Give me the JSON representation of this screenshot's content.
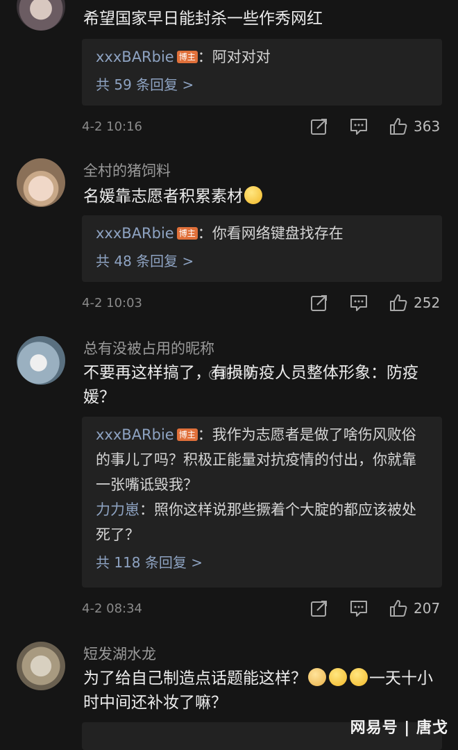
{
  "comments": [
    {
      "username": "",
      "text": "希望国家早日能封杀一些作秀网红",
      "replies": [
        {
          "name": "xxxBARbie",
          "badge": "博主",
          "text": "：阿对对对"
        }
      ],
      "reply_count": "共 59 条回复 >",
      "time": "4-2 10:16",
      "likes": "363"
    },
    {
      "username": "全村的猪饲料",
      "text": "名媛靠志愿者积累素材",
      "replies": [
        {
          "name": "xxxBARbie",
          "badge": "博主",
          "text": "：你看网络键盘找存在"
        }
      ],
      "reply_count": "共 48 条回复 >",
      "time": "4-2 10:03",
      "likes": "252"
    },
    {
      "username": "总有没被占用的昵称",
      "text": "不要再这样搞了，有损防疫人员整体形象：防疫媛？",
      "overlay_text": "@那件事",
      "replies": [
        {
          "name": "xxxBARbie",
          "badge": "博主",
          "text": "：我作为志愿者是做了啥伤风败俗的事儿了吗？积极正能量对抗疫情的付出，你就靠一张嘴诋毁我？"
        },
        {
          "name": "力力崽",
          "badge": "",
          "text": "：照你这样说那些撅着个大腚的都应该被处死了？"
        }
      ],
      "reply_count": "共 118 条回复 >",
      "time": "4-2 08:34",
      "likes": "207"
    },
    {
      "username": "短发湖水龙",
      "text_before": "为了给自己制造点话题能这样？",
      "text_after": "一天十小时中间还补妆了嘛？"
    }
  ],
  "watermark": "网易号 | 唐戈",
  "icons": [
    "share-icon",
    "message-icon",
    "thumbs-up-icon"
  ],
  "colors": {
    "background": "#151515",
    "reply_box": "#222222",
    "link": "#8ea3c2",
    "badge": "#e0703a"
  }
}
